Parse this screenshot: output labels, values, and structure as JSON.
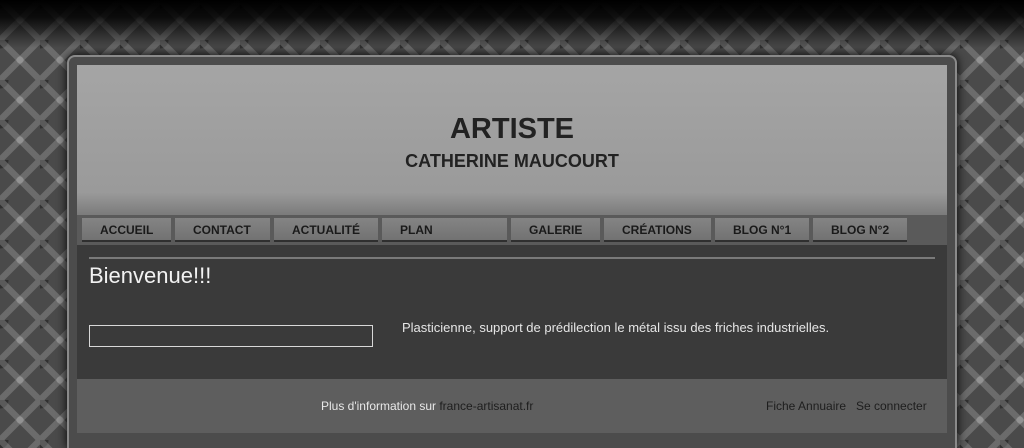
{
  "header": {
    "title": "ARTISTE",
    "subtitle": "CATHERINE MAUCOURT"
  },
  "nav": {
    "items": [
      {
        "label": "ACCUEIL"
      },
      {
        "label": "CONTACT"
      },
      {
        "label": "ACTUALITÉ"
      },
      {
        "label": "PLAN"
      },
      {
        "label": "GALERIE"
      },
      {
        "label": "CRÉATIONS"
      },
      {
        "label": "BLOG N°1"
      },
      {
        "label": "BLOG N°2"
      }
    ]
  },
  "main": {
    "title": "Bienvenue!!!",
    "intro": "Plasticienne, support de prédilection le métal issu des friches industrielles."
  },
  "footer": {
    "info_prefix": "Plus d'information sur ",
    "info_link": "france-artisanat.fr",
    "annuaire_link": "Fiche Annuaire",
    "login_link": "Se connecter"
  }
}
